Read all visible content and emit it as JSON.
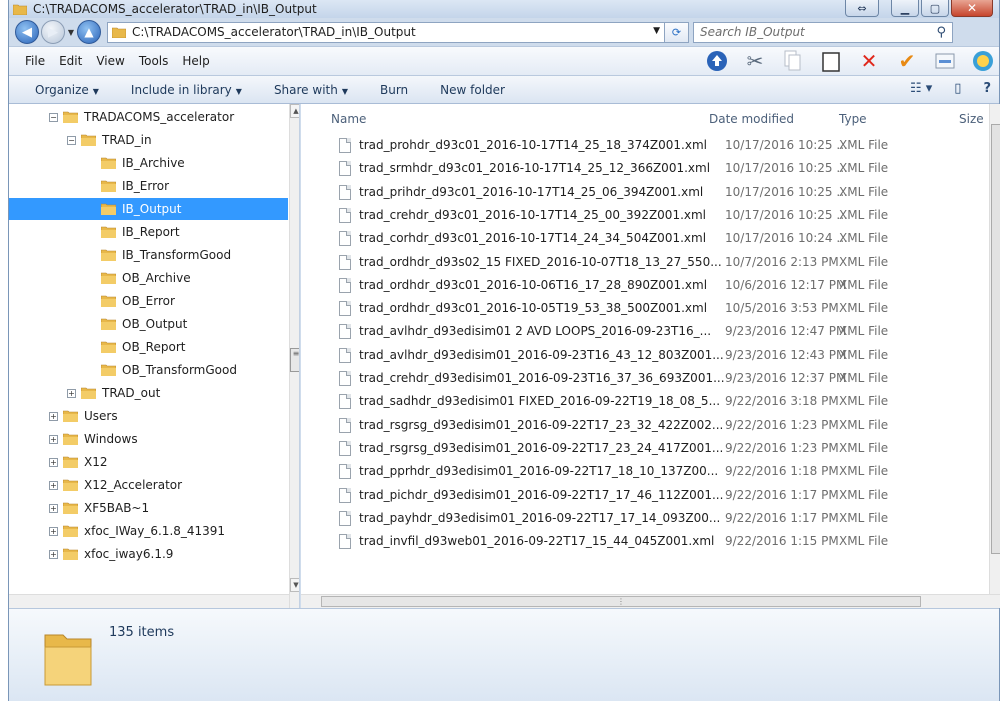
{
  "window": {
    "title": "C:\\TRADACOMS_accelerator\\TRAD_in\\IB_Output"
  },
  "address": {
    "path": "C:\\TRADACOMS_accelerator\\TRAD_in\\IB_Output",
    "search_placeholder": "Search IB_Output"
  },
  "menu": {
    "file": "File",
    "edit": "Edit",
    "view": "View",
    "tools": "Tools",
    "help": "Help"
  },
  "commands": {
    "organize": "Organize",
    "include": "Include in library",
    "share": "Share with",
    "burn": "Burn",
    "new_folder": "New folder"
  },
  "tree": [
    {
      "label": "TRADACOMS_accelerator",
      "exp": "⊟"
    },
    {
      "label": "TRAD_in",
      "exp": "⊟"
    },
    {
      "label": "IB_Archive",
      "exp": ""
    },
    {
      "label": "IB_Error",
      "exp": ""
    },
    {
      "label": "IB_Output",
      "exp": ""
    },
    {
      "label": "IB_Report",
      "exp": ""
    },
    {
      "label": "IB_TransformGood",
      "exp": ""
    },
    {
      "label": "OB_Archive",
      "exp": ""
    },
    {
      "label": "OB_Error",
      "exp": ""
    },
    {
      "label": "OB_Output",
      "exp": ""
    },
    {
      "label": "OB_Report",
      "exp": ""
    },
    {
      "label": "OB_TransformGood",
      "exp": ""
    },
    {
      "label": "TRAD_out",
      "exp": "⊞"
    },
    {
      "label": "Users",
      "exp": "⊞"
    },
    {
      "label": "Windows",
      "exp": "⊞"
    },
    {
      "label": "X12",
      "exp": "⊞"
    },
    {
      "label": "X12_Accelerator",
      "exp": "⊞"
    },
    {
      "label": "XF5BAB~1",
      "exp": "⊞"
    },
    {
      "label": "xfoc_IWay_6.1.8_41391",
      "exp": "⊞"
    },
    {
      "label": "xfoc_iway6.1.9",
      "exp": "⊞"
    }
  ],
  "columns": {
    "name": "Name",
    "date": "Date modified",
    "type": "Type",
    "size": "Size"
  },
  "files": [
    {
      "name": "trad_prohdr_d93c01_2016-10-17T14_25_18_374Z001.xml",
      "date": "10/17/2016 10:25 ...",
      "type": "XML File"
    },
    {
      "name": "trad_srmhdr_d93c01_2016-10-17T14_25_12_366Z001.xml",
      "date": "10/17/2016 10:25 ...",
      "type": "XML File"
    },
    {
      "name": "trad_prihdr_d93c01_2016-10-17T14_25_06_394Z001.xml",
      "date": "10/17/2016 10:25 ...",
      "type": "XML File"
    },
    {
      "name": "trad_crehdr_d93c01_2016-10-17T14_25_00_392Z001.xml",
      "date": "10/17/2016 10:25 ...",
      "type": "XML File"
    },
    {
      "name": "trad_corhdr_d93c01_2016-10-17T14_24_34_504Z001.xml",
      "date": "10/17/2016 10:24 ...",
      "type": "XML File"
    },
    {
      "name": "trad_ordhdr_d93s02_15 FIXED_2016-10-07T18_13_27_550...",
      "date": "10/7/2016 2:13 PM",
      "type": "XML File"
    },
    {
      "name": "trad_ordhdr_d93c01_2016-10-06T16_17_28_890Z001.xml",
      "date": "10/6/2016 12:17 PM",
      "type": "XML File"
    },
    {
      "name": "trad_ordhdr_d93c01_2016-10-05T19_53_38_500Z001.xml",
      "date": "10/5/2016 3:53 PM",
      "type": "XML File"
    },
    {
      "name": "trad_avlhdr_d93edisim01 2 AVD LOOPS_2016-09-23T16_...",
      "date": "9/23/2016 12:47 PM",
      "type": "XML File"
    },
    {
      "name": "trad_avlhdr_d93edisim01_2016-09-23T16_43_12_803Z001...",
      "date": "9/23/2016 12:43 PM",
      "type": "XML File"
    },
    {
      "name": "trad_crehdr_d93edisim01_2016-09-23T16_37_36_693Z001...",
      "date": "9/23/2016 12:37 PM",
      "type": "XML File"
    },
    {
      "name": "trad_sadhdr_d93edisim01 FIXED_2016-09-22T19_18_08_5...",
      "date": "9/22/2016 3:18 PM",
      "type": "XML File"
    },
    {
      "name": "trad_rsgrsg_d93edisim01_2016-09-22T17_23_32_422Z002...",
      "date": "9/22/2016 1:23 PM",
      "type": "XML File"
    },
    {
      "name": "trad_rsgrsg_d93edisim01_2016-09-22T17_23_24_417Z001...",
      "date": "9/22/2016 1:23 PM",
      "type": "XML File"
    },
    {
      "name": "trad_pprhdr_d93edisim01_2016-09-22T17_18_10_137Z00...",
      "date": "9/22/2016 1:18 PM",
      "type": "XML File"
    },
    {
      "name": "trad_pichdr_d93edisim01_2016-09-22T17_17_46_112Z001...",
      "date": "9/22/2016 1:17 PM",
      "type": "XML File"
    },
    {
      "name": "trad_payhdr_d93edisim01_2016-09-22T17_17_14_093Z00...",
      "date": "9/22/2016 1:17 PM",
      "type": "XML File"
    },
    {
      "name": "trad_invfil_d93web01_2016-09-22T17_15_44_045Z001.xml",
      "date": "9/22/2016 1:15 PM",
      "type": "XML File"
    }
  ],
  "status": {
    "count": "135 items"
  },
  "colors": {
    "selection": "#3399ff",
    "folder": "#e8b84a"
  }
}
